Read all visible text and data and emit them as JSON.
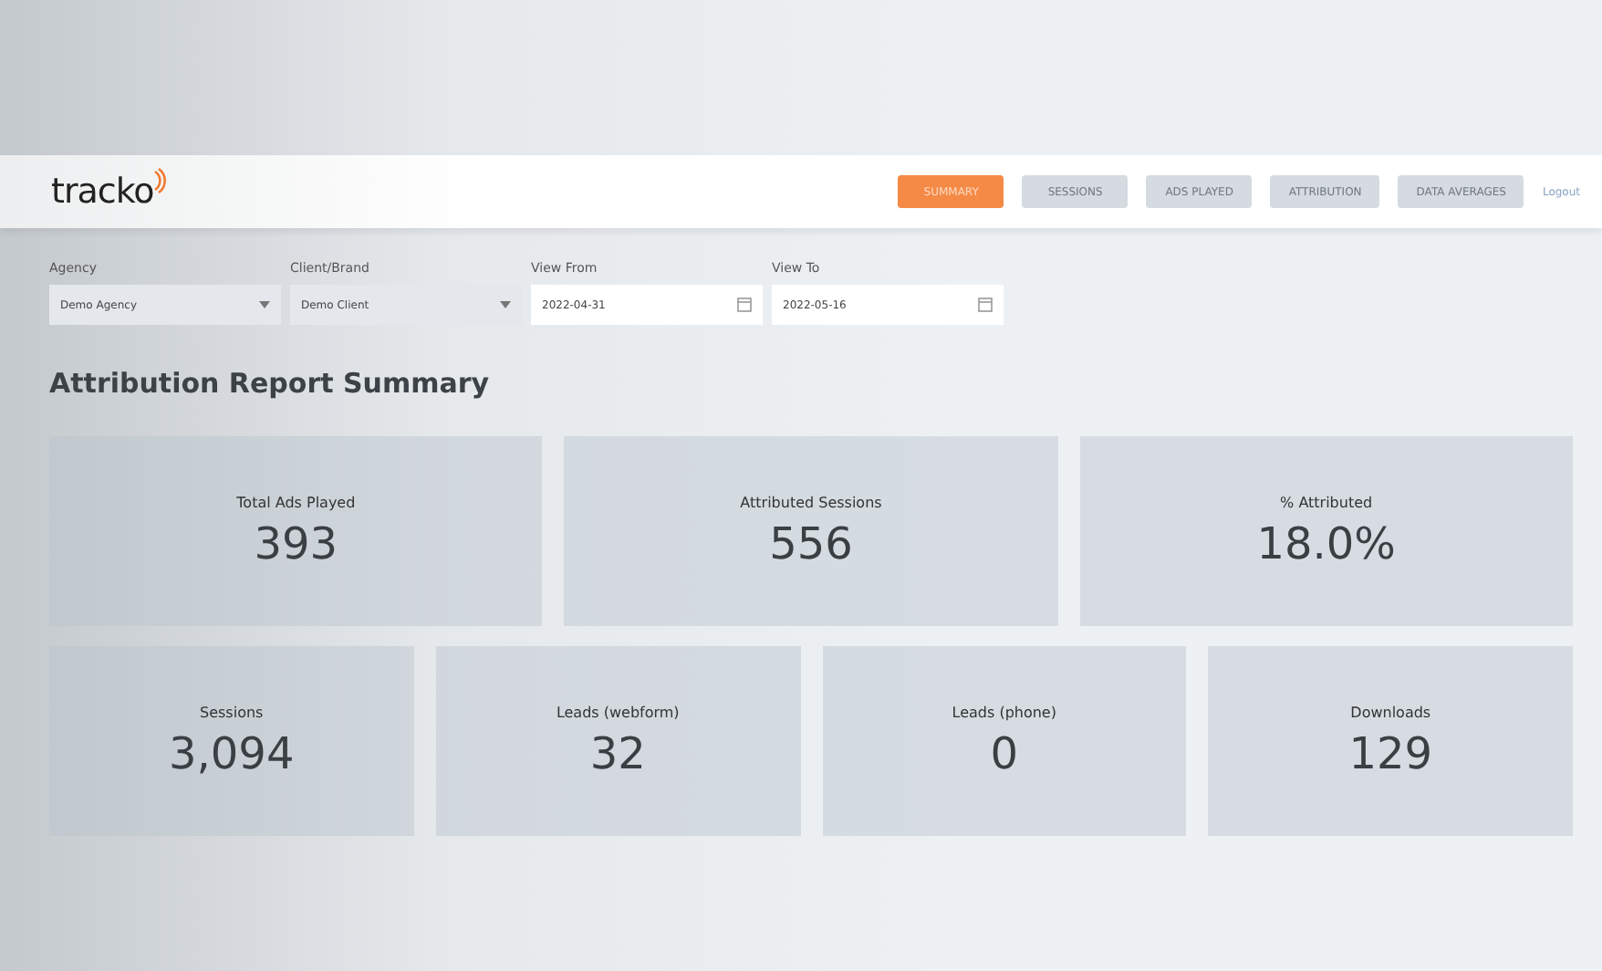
{
  "header": {
    "logo": "tracko",
    "nav": [
      {
        "label": "SUMMARY",
        "selected": true
      },
      {
        "label": "SESSIONS",
        "selected": false
      },
      {
        "label": "ADS PLAYED",
        "selected": false
      },
      {
        "label": "ATTRIBUTION",
        "selected": false
      },
      {
        "label": "DATA AVERAGES",
        "selected": false
      }
    ],
    "logout": "Logout"
  },
  "filters": [
    {
      "kind": "select",
      "label": "Agency",
      "value": "Demo Agency"
    },
    {
      "kind": "select",
      "label": "Client/Brand",
      "value": "Demo Client"
    },
    {
      "kind": "date",
      "label": "View From",
      "value": "2022-04-31"
    },
    {
      "kind": "date",
      "label": "View To",
      "value": "2022-05-16"
    }
  ],
  "title": "Attribution Report Summary",
  "rows": [
    [
      {
        "label": "Total Ads Played",
        "value": "393"
      },
      {
        "label": "Attributed Sessions",
        "value": "556"
      },
      {
        "label": "% Attributed",
        "value": "18.0%"
      }
    ],
    [
      {
        "label": "Sessions",
        "value": "3,094"
      },
      {
        "label": "Leads (webform)",
        "value": "32"
      },
      {
        "label": "Leads (phone)",
        "value": "0"
      },
      {
        "label": "Downloads",
        "value": "129"
      }
    ]
  ]
}
